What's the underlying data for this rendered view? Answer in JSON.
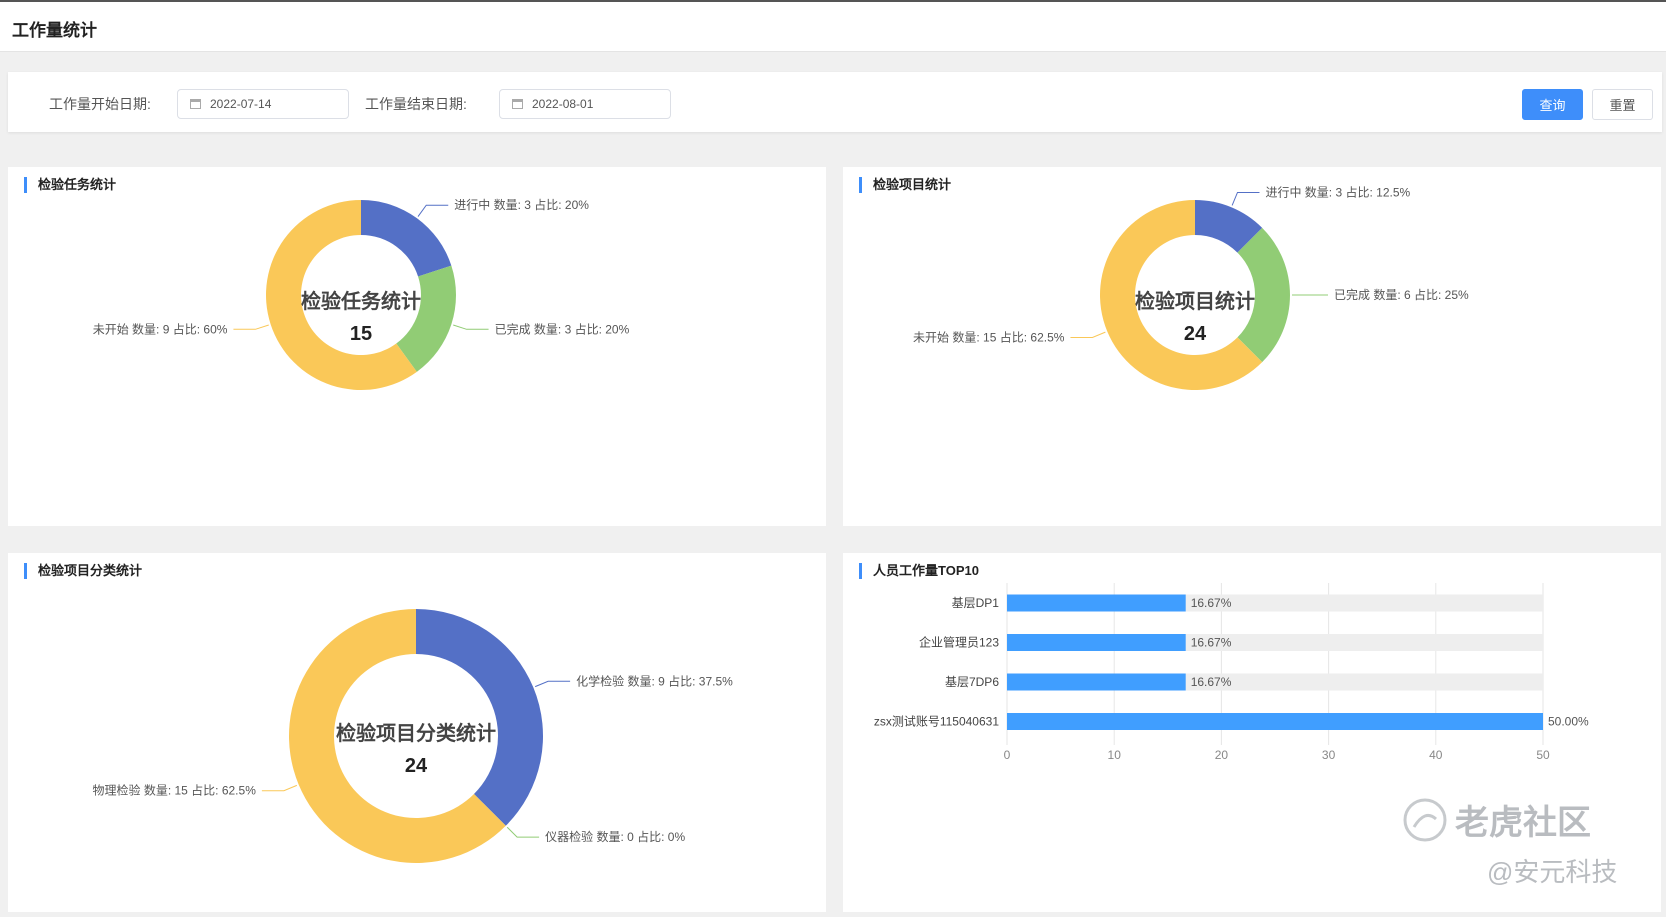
{
  "page": {
    "title": "工作量统计"
  },
  "filters": {
    "start_label": "工作量开始日期:",
    "start_value": "2022-07-14",
    "end_label": "工作量结束日期:",
    "end_value": "2022-08-01",
    "query_button": "查询",
    "reset_button": "重置"
  },
  "colors": {
    "blue": "#5470c6",
    "green": "#91cc75",
    "yellow": "#fac858",
    "bar": "#409eff",
    "bar_bg": "#eeeeee",
    "accent": "#3e8efa"
  },
  "watermark": {
    "line1": "老虎社区",
    "line2": "@安元科技"
  },
  "chart_data": [
    {
      "type": "pie",
      "card_title": "检验任务统计",
      "center_title": "检验任务统计",
      "center_value": "15",
      "slices": [
        {
          "name": "进行中",
          "value": 3,
          "percent": "20%",
          "label": "进行中 数量: 3 占比: 20%",
          "color": "#5470c6"
        },
        {
          "name": "已完成",
          "value": 3,
          "percent": "20%",
          "label": "已完成 数量: 3 占比: 20%",
          "color": "#91cc75"
        },
        {
          "name": "未开始",
          "value": 9,
          "percent": "60%",
          "label": "未开始 数量: 9 占比: 60%",
          "color": "#fac858"
        }
      ]
    },
    {
      "type": "pie",
      "card_title": "检验项目统计",
      "center_title": "检验项目统计",
      "center_value": "24",
      "slices": [
        {
          "name": "进行中",
          "value": 3,
          "percent": "12.5%",
          "label": "进行中 数量: 3 占比: 12.5%",
          "color": "#5470c6"
        },
        {
          "name": "已完成",
          "value": 6,
          "percent": "25%",
          "label": "已完成 数量: 6 占比: 25%",
          "color": "#91cc75"
        },
        {
          "name": "未开始",
          "value": 15,
          "percent": "62.5%",
          "label": "未开始 数量: 15 占比: 62.5%",
          "color": "#fac858"
        }
      ]
    },
    {
      "type": "pie",
      "card_title": "检验项目分类统计",
      "center_title": "检验项目分类统计",
      "center_value": "24",
      "slices": [
        {
          "name": "化学检验",
          "value": 9,
          "percent": "37.5%",
          "label": "化学检验 数量: 9 占比: 37.5%",
          "color": "#5470c6"
        },
        {
          "name": "仪器检验",
          "value": 0,
          "percent": "0%",
          "label": "仪器检验 数量: 0 占比: 0%",
          "color": "#91cc75"
        },
        {
          "name": "物理检验",
          "value": 15,
          "percent": "62.5%",
          "label": "物理检验 数量: 15 占比: 62.5%",
          "color": "#fac858"
        }
      ]
    },
    {
      "type": "bar",
      "orientation": "horizontal",
      "card_title": "人员工作量TOP10",
      "categories": [
        "基层DP1",
        "企业管理员123",
        "基层7DP6",
        "zsx测试账号115040631"
      ],
      "values": [
        16.67,
        16.67,
        16.67,
        50.0
      ],
      "value_labels": [
        "16.67%",
        "16.67%",
        "16.67%",
        "50.00%"
      ],
      "xlim": [
        0,
        50
      ],
      "xticks": [
        "0",
        "10",
        "20",
        "30",
        "40",
        "50"
      ],
      "grid": true
    }
  ]
}
